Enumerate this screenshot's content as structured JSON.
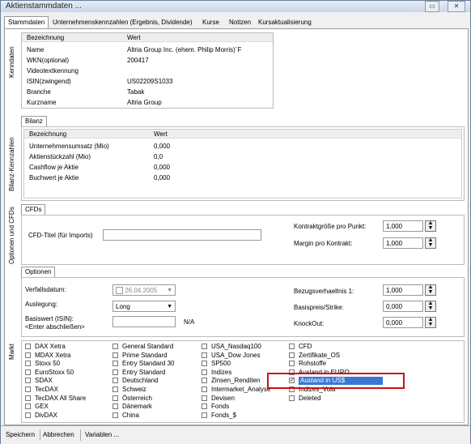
{
  "window": {
    "title": "Aktienstammdaten ..."
  },
  "tabs": [
    "Stammdaten",
    "Unternehmenskennzahlen (Ergebnis, Dividende)",
    "Kurse",
    "Notizen",
    "Kursaktualisierung"
  ],
  "side_labels": {
    "kenndaten": "Kenndaten",
    "bilanz": "Bilanz-Kennzahlen",
    "optionen": "Optionen und CFDs",
    "markt": "Markt"
  },
  "kenndaten": {
    "headers": [
      "Bezeichnung",
      "Wert"
    ],
    "rows": [
      [
        "Name",
        "Altria Group Inc. (ehem. Philip Morris)´F"
      ],
      [
        "WKN(optional)",
        "200417"
      ],
      [
        "Videotextkennung",
        ""
      ],
      [
        "ISIN(zwingend)",
        "US02209S1033"
      ],
      [
        "Branche",
        "Tabak"
      ],
      [
        "Kurzname",
        "Altria Group"
      ]
    ]
  },
  "bilanz": {
    "tab": "Bilanz",
    "headers": [
      "Bezeichnung",
      "Wert"
    ],
    "rows": [
      [
        "Unternehmensumsatz (Mio)",
        "0,000"
      ],
      [
        "Aktienstückzahl (Mio)",
        "0,0"
      ],
      [
        "Cashflow je Aktie",
        "0,000"
      ],
      [
        "Buchwert je Aktie",
        "0,000"
      ]
    ]
  },
  "cfds": {
    "tab": "CFDs",
    "title_label": "CFD-Titel (für Imports)",
    "title_value": "",
    "kontrakt_label": "Kontraktgröße pro Punkt:",
    "kontrakt_value": "1,000",
    "margin_label": "Margin pro Kontrakt:",
    "margin_value": "1,000"
  },
  "optionen": {
    "tab": "Optionen",
    "verfall_label": "Verfallsdatum:",
    "verfall_value": "26.04.2005",
    "auslegung_label": "Auslegung:",
    "auslegung_value": "Long",
    "basiswert_label": "Basiswert (ISIN):",
    "basiswert_hint": "<Enter abschließen>",
    "basiswert_value": "",
    "basiswert_na": "N/A",
    "bezug_label": "Bezugsverhaeltnis 1:",
    "bezug_value": "1,000",
    "basispreis_label": "Basispreis/Strike:",
    "basispreis_value": "0,000",
    "knockout_label": "KnockOut:",
    "knockout_value": "0,000"
  },
  "markt": {
    "columns": [
      [
        "DAX Xetra",
        "MDAX Xetra",
        "Stoxx 50",
        "EuroStoxx 50",
        "SDAX",
        "TecDAX",
        "TecDAX All Share",
        "GEX",
        "DivDAX"
      ],
      [
        "General Standard",
        "Prime Standard",
        "Entry Standard 30",
        "Entry Standard",
        "Deutschland",
        "Schweiz",
        "Österreich",
        "Dänemark",
        "China"
      ],
      [
        "USA_Nasdaq100",
        "USA_Dow Jones",
        "SP500",
        "Indizes",
        "Zinsen_Renditen",
        "Intermarket_Analyse",
        "Devisen",
        "Fonds",
        "Fonds_$"
      ],
      [
        "CFD",
        "Zertifikate_OS",
        "Rohstoffe",
        "Ausland in EURO",
        "Ausland in US$",
        "Indizes_Vola",
        "Deleted"
      ]
    ],
    "checked": "Ausland in US$"
  },
  "footer": {
    "save": "Speichern",
    "cancel": "Abbrechen",
    "variables": "Variablen ..."
  }
}
